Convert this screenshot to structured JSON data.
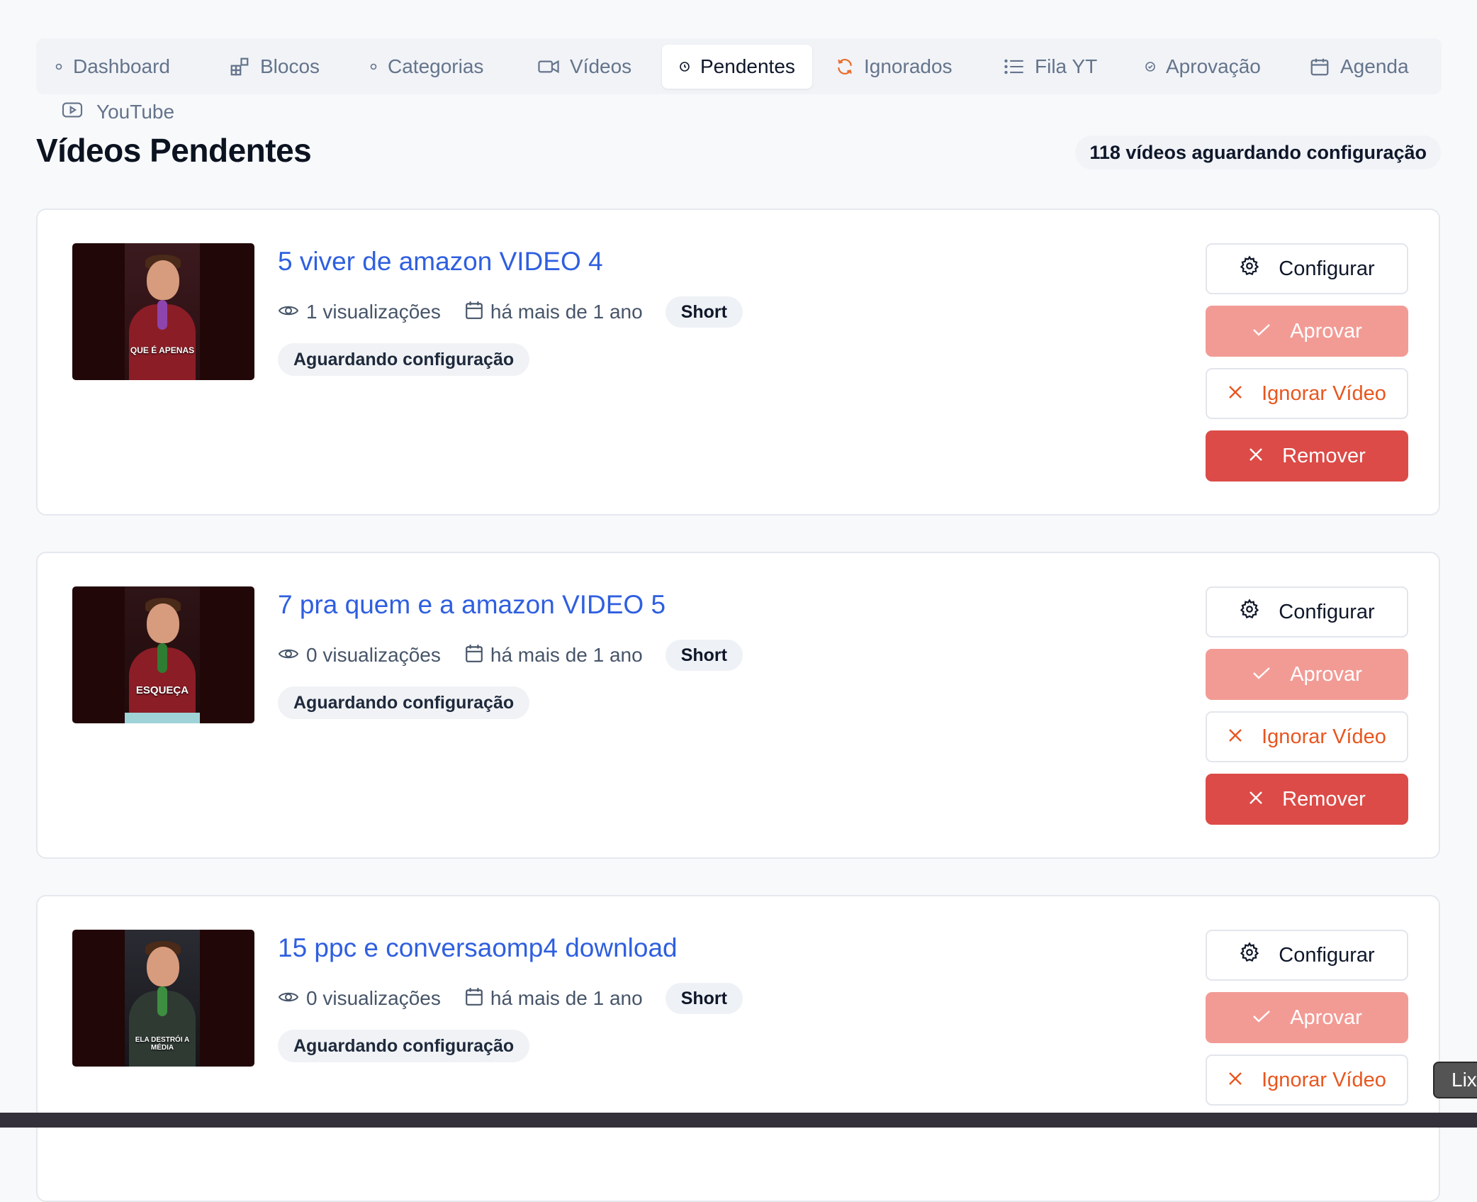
{
  "nav": {
    "tabs": [
      {
        "label": "Dashboard",
        "icon": "dot-icon"
      },
      {
        "label": "Blocos",
        "icon": "blocks-icon"
      },
      {
        "label": "Categorias",
        "icon": "dot-icon"
      },
      {
        "label": "Vídeos",
        "icon": "video-camera-icon"
      },
      {
        "label": "Pendentes",
        "icon": "clock-icon",
        "active": true
      },
      {
        "label": "Ignorados",
        "icon": "refresh-icon"
      },
      {
        "label": "Fila YT",
        "icon": "list-icon"
      },
      {
        "label": "Aprovação",
        "icon": "check-circle-icon"
      },
      {
        "label": "Agenda",
        "icon": "calendar-icon"
      },
      {
        "label": "YouTube",
        "icon": "youtube-icon"
      }
    ]
  },
  "page": {
    "title": "Vídeos Pendentes",
    "count_label": "118 vídeos aguardando configuração"
  },
  "videos": [
    {
      "title": "5 viver de amazon VIDEO 4",
      "views": "1 visualizações",
      "date": "há mais de 1 ano",
      "type": "Short",
      "status": "Aguardando configuração",
      "thumb_caption": "QUE É APENAS"
    },
    {
      "title": "7 pra quem e a amazon VIDEO 5",
      "views": "0 visualizações",
      "date": "há mais de 1 ano",
      "type": "Short",
      "status": "Aguardando configuração",
      "thumb_caption": "ESQUEÇA"
    },
    {
      "title": "15 ppc e conversaomp4 download",
      "views": "0 visualizações",
      "date": "há mais de 1 ano",
      "type": "Short",
      "status": "Aguardando configuração",
      "thumb_caption": "ELA DESTRÓI A MÉDIA"
    }
  ],
  "actions": {
    "configure": "Configurar",
    "approve": "Aprovar",
    "ignore": "Ignorar Vídeo",
    "remove": "Remover"
  },
  "tooltip": {
    "text": "Lix"
  },
  "colors": {
    "link": "#2f5fe0",
    "approve": "#f29b95",
    "remove": "#dc4b47",
    "ignore": "#e8561f",
    "active_tab_bg": "#ffffff"
  }
}
